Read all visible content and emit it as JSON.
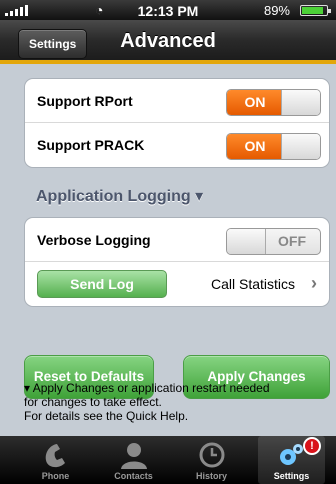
{
  "status_bar": {
    "time": "12:13 PM",
    "battery_percent_text": "89%",
    "battery_level": 0.89,
    "wifi_icon": "wifi-icon"
  },
  "nav": {
    "back_label": "Settings",
    "title": "Advanced",
    "accent_color": "#e3a60a"
  },
  "rport": {
    "label": "Support RPort",
    "state": "ON"
  },
  "prack": {
    "label": "Support PRACK",
    "state": "ON"
  },
  "logging": {
    "section_title": "Application Logging ▾",
    "verbose_label": "Verbose Logging",
    "verbose_state": "OFF",
    "send_log_label": "Send Log",
    "call_stats_label": "Call Statistics"
  },
  "actions": {
    "reset_label": "Reset to Defaults",
    "apply_label": "Apply Changes"
  },
  "help": {
    "line1": "▾ Apply Changes or application restart needed",
    "line2": "for changes to take effect.",
    "line3": "For details see the Quick Help."
  },
  "tabs": [
    {
      "label": "Phone",
      "icon": "phone-icon"
    },
    {
      "label": "Contacts",
      "icon": "contacts-icon"
    },
    {
      "label": "History",
      "icon": "history-clock-icon"
    },
    {
      "label": "Settings",
      "icon": "settings-gears-icon",
      "badge": "!"
    }
  ]
}
